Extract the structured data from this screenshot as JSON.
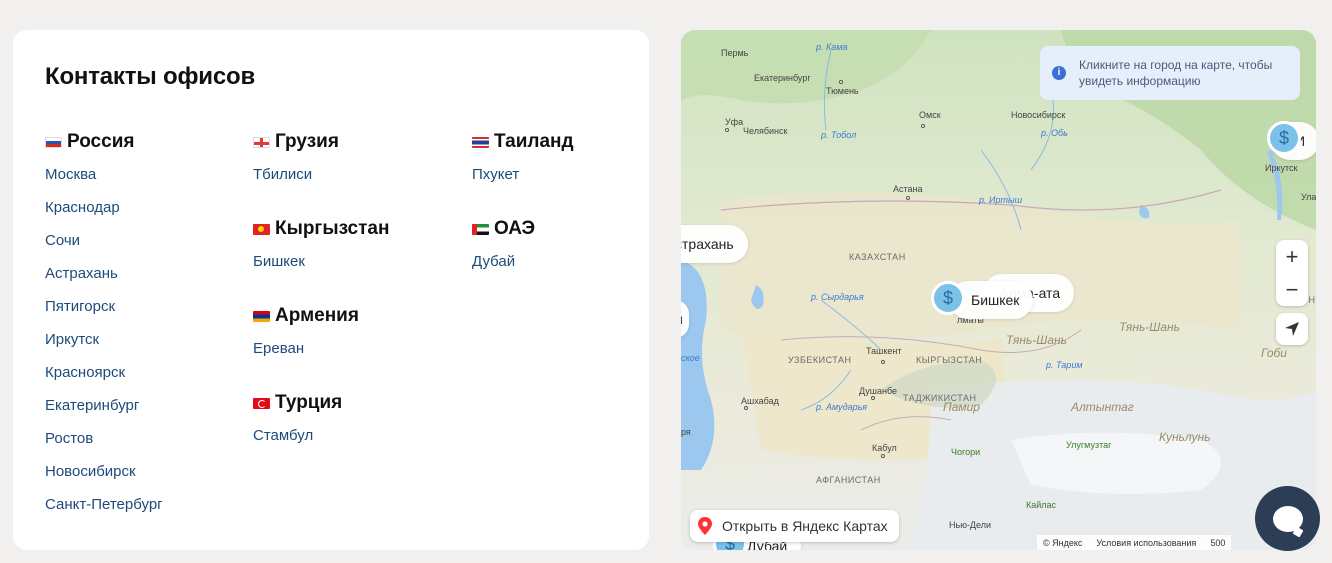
{
  "contacts": {
    "title": "Контакты офисов",
    "columns": [
      {
        "groups": [
          {
            "country": "Россия",
            "flag": "flag-ru",
            "cities": [
              "Москва",
              "Краснодар",
              "Сочи",
              "Астрахань",
              "Пятигорск",
              "Иркутск",
              "Красноярск",
              "Екатеринбург",
              "Ростов",
              "Новосибирск",
              "Санкт-Петербург"
            ]
          }
        ]
      },
      {
        "groups": [
          {
            "country": "Грузия",
            "flag": "flag-ge",
            "cities": [
              "Тбилиси"
            ]
          },
          {
            "country": "Кыргызстан",
            "flag": "flag-kg",
            "cities": [
              "Бишкек"
            ]
          },
          {
            "country": "Армения",
            "flag": "flag-am",
            "cities": [
              "Ереван"
            ]
          },
          {
            "country": "Турция",
            "flag": "flag-tr",
            "cities": [
              "Стамбул"
            ]
          }
        ]
      },
      {
        "groups": [
          {
            "country": "Таиланд",
            "flag": "flag-th",
            "cities": [
              "Пхукет"
            ]
          },
          {
            "country": "ОАЭ",
            "flag": "flag-ae",
            "cities": [
              "Дубай"
            ]
          }
        ]
      }
    ]
  },
  "map": {
    "info_text": "Кликните на город на карте, чтобы увидеть информацию",
    "zoom_in": "+",
    "zoom_out": "−",
    "open_button": "Открыть в Яндекс Картах",
    "copyright": "© Яндекс",
    "terms": "Условия использования",
    "scale": "500",
    "chips": {
      "astrakhan": "страхань",
      "bishkek": "Бишкек",
      "almaty": "Алма-ата",
      "dubai": "Дубай",
      "irkutsk": "И",
      "left_cut": "и"
    },
    "labels": {
      "perm": "Пермь",
      "ekaterinburg": "Екатеринбург",
      "tyumen": "Тюмень",
      "ufa": "Уфа",
      "chelyabinsk": "Челябинск",
      "omsk": "Омск",
      "novosibirsk": "Новосибирск",
      "astana": "Астана",
      "kazakhstan": "КАЗАХСТАН",
      "uzbekistan": "УЗБЕКИСТАН",
      "tashkent": "Ташкент",
      "kyrgyzstan": "КЫРГЫЗСТАН",
      "dushanbe": "Душанбе",
      "tajikistan": "ТАДЖИКИСТАН",
      "ashgabat": "Ашхабад",
      "kabul": "Кабул",
      "afghanistan": "АФГАНИСТАН",
      "new_delhi": "Нью-Дели",
      "pamir": "Памир",
      "tien_shan": "Тянь-Шань",
      "tien_shan2": "Тянь-Шань",
      "gobi": "Гоби",
      "altyntag": "Алтынтаг",
      "kunlun": "Куньлунь",
      "chogori": "Чогори",
      "ulugmuztag": "Улугмузтаг",
      "kailas": "Кайлас",
      "mongolia": "МОНГ",
      "irkutsk_city": "Иркутск",
      "ulan": "Ула",
      "kama": "р. Кама",
      "tobol": "р. Тобол",
      "irtysh": "р. Иртыш",
      "syrdarya": "р. Сырдарья",
      "amudarya": "р. Амударья",
      "tarim": "р. Тарим",
      "caspian": "ское",
      "lake_cut": "ря",
      "almaty_small": "лматы",
      "ob": "р. Обь"
    }
  }
}
